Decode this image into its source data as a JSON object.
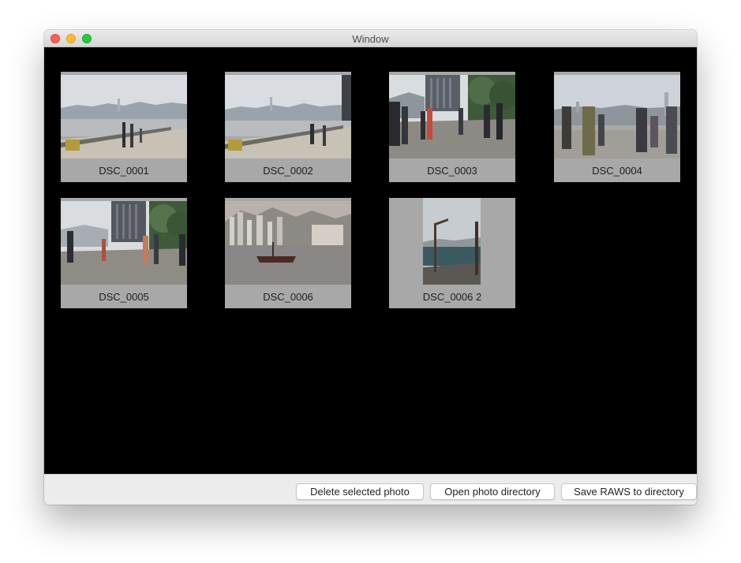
{
  "window": {
    "title": "Window"
  },
  "photos": [
    {
      "label": "DSC_0001",
      "thumbnail": "harbor-promenade-skyline"
    },
    {
      "label": "DSC_0002",
      "thumbnail": "harbor-promenade-skyline"
    },
    {
      "label": "DSC_0003",
      "thumbnail": "promenade-crowd-building"
    },
    {
      "label": "DSC_0004",
      "thumbnail": "promenade-crowd-skyline"
    },
    {
      "label": "DSC_0005",
      "thumbnail": "promenade-walkway-tower"
    },
    {
      "label": "DSC_0006",
      "thumbnail": "junk-boat-city-hills"
    },
    {
      "label": "DSC_0006 2",
      "thumbnail": "lamp-post-harbor-portrait"
    }
  ],
  "toolbar": {
    "delete_label": "Delete selected photo",
    "open_label": "Open photo directory",
    "save_label": "Save RAWS to directory"
  },
  "colors": {
    "grid_background": "#000000",
    "tile_background": "#a8a8a8",
    "close": "#fe5f57",
    "minimize": "#febc2e",
    "maximize": "#28c840"
  }
}
